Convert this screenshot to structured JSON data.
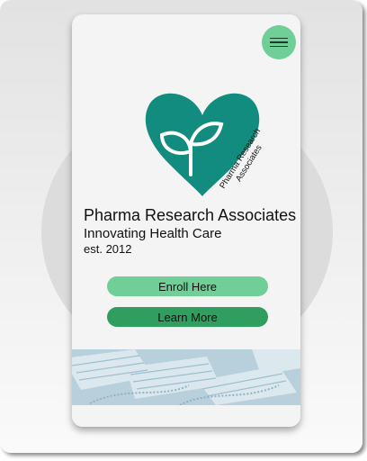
{
  "brand": {
    "name": "Pharma Research Associates",
    "tagline": "Innovating Health Care",
    "established": "est. 2012",
    "logo_text_line1": "Pharma Research",
    "logo_text_line2": "Associates",
    "primary_color": "#128c7e",
    "accent_light": "#6fcf97",
    "accent_dark": "#2f9e5e"
  },
  "header": {
    "menu_icon": "hamburger-menu-icon"
  },
  "actions": {
    "enroll_label": "Enroll Here",
    "learn_label": "Learn More"
  },
  "hero_image": {
    "subject": "surgical-face-masks"
  }
}
